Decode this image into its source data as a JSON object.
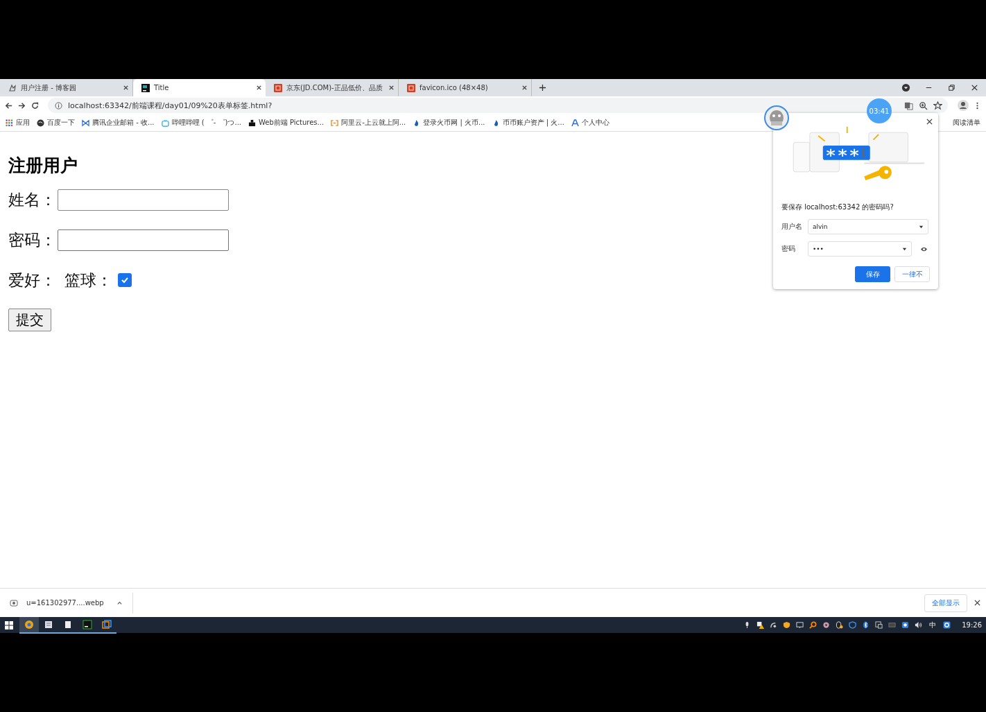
{
  "browser": {
    "tabs": [
      {
        "title": "用户注册 - 博客园",
        "selected": false
      },
      {
        "title": "Title",
        "selected": true
      },
      {
        "title": "京东(JD.COM)-正品低价、品质",
        "selected": false
      },
      {
        "title": "favicon.ico (48×48)",
        "selected": false
      }
    ],
    "address": "localhost:63342/前端课程/day01/09%20表单标签.html?",
    "bookmarks": [
      {
        "label": "应用"
      },
      {
        "label": "百度一下"
      },
      {
        "label": "腾讯企业邮箱 - 收..."
      },
      {
        "label": "哔哩哔哩 ( ゜- ゜)つ..."
      },
      {
        "label": "Web前端 Pictures..."
      },
      {
        "label": "阿里云-上云就上阿..."
      },
      {
        "label": "登录火币网 | 火币..."
      },
      {
        "label": "币币账户资产 | 火..."
      },
      {
        "label": "个人中心"
      }
    ],
    "reading_list": "阅读清单"
  },
  "page": {
    "heading": "注册用户",
    "fields": [
      {
        "label": "姓名：",
        "kind": "text"
      },
      {
        "label": "密码：",
        "kind": "password"
      }
    ],
    "hobby": {
      "label": "爱好：",
      "option": "篮球：",
      "checked": true
    },
    "submit": "提交"
  },
  "password_popup": {
    "question": "要保存 localhost:63342 的密码吗?",
    "username_label": "用户名",
    "username": "alvin",
    "password_label": "密码",
    "password": "•••",
    "save": "保存",
    "never": "一律不"
  },
  "timer": "03:41",
  "download": {
    "file": "u=161302977....webp",
    "show_all": "全部显示"
  },
  "taskbar": {
    "ime": "中",
    "clock": "19:26"
  }
}
